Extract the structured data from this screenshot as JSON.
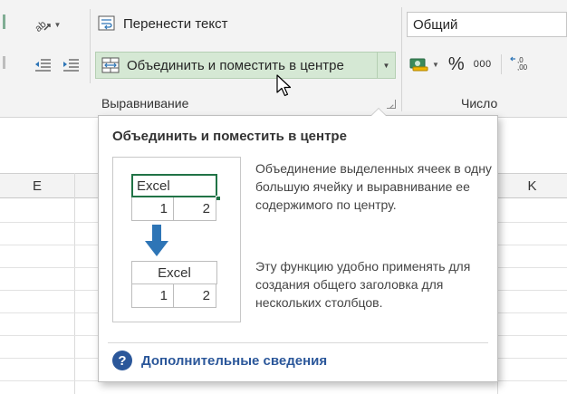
{
  "ribbon": {
    "alignment": {
      "wrap_text_label": "Перенести текст",
      "merge_center_label": "Объединить и поместить в центре",
      "group_label": "Выравнивание"
    },
    "number": {
      "format_value": "Общий",
      "percent_symbol": "%",
      "thousands_symbol": "000",
      "group_label": "Число"
    }
  },
  "sheet": {
    "columns": [
      {
        "label": "E"
      },
      {
        "label": "K"
      }
    ]
  },
  "tooltip": {
    "title": "Объединить и поместить в центре",
    "description_1": "Объединение выделенных ячеек в одну большую ячейку и выравнивание ее содержимого по центру.",
    "description_2": "Эту функцию удобно применять для создания общего заголовка для нескольких столбцов.",
    "more_info": "Дополнительные сведения",
    "help_symbol": "?",
    "illustration": {
      "before": {
        "merged": "Excel",
        "cells": [
          "1",
          "2"
        ]
      },
      "after": {
        "merged": "Excel",
        "cells": [
          "1",
          "2"
        ]
      }
    }
  },
  "colors": {
    "accent_green": "#217346",
    "hover_green": "#d5e8d4",
    "link_blue": "#2b579a",
    "arrow_blue": "#2e75b6"
  }
}
